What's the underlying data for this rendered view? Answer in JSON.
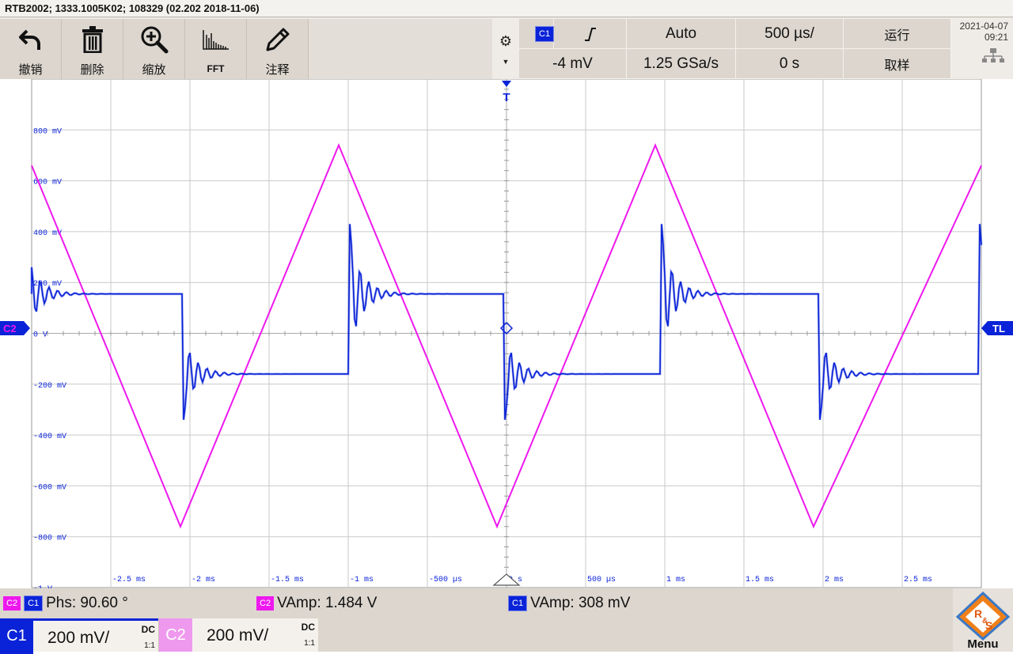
{
  "window": {
    "title": "RTB2002; 1333.1005K02; 108329 (02.202 2018-11-06)"
  },
  "toolbar": {
    "tools": [
      {
        "label": "撤销",
        "icon": "undo-icon"
      },
      {
        "label": "删除",
        "icon": "trash-icon"
      },
      {
        "label": "缩放",
        "icon": "zoom-icon"
      },
      {
        "label": "FFT",
        "icon": "fft-icon"
      },
      {
        "label": "注释",
        "icon": "pencil-icon"
      }
    ],
    "settings_icon": "gear-icon",
    "trigger_channel": "C1",
    "trigger_slope_icon": "rising-edge-icon",
    "trigger_mode": "Auto",
    "timebase": "500 µs/",
    "run_state": "运行",
    "trigger_level": "-4 mV",
    "sample_rate": "1.25 GSa/s",
    "horizontal_position": "0 s",
    "acquisition_mode": "取样",
    "date": "2021-04-07",
    "time": "09:21",
    "network_icon": "network-icon"
  },
  "plot": {
    "y_labels": [
      "800 mV",
      "600 mV",
      "400 mV",
      "200 mV",
      "0 V",
      "-200 mV",
      "-400 mV",
      "-600 mV",
      "-800 mV",
      "-1 V"
    ],
    "x_labels": [
      "-2.5 ms",
      "-2 ms",
      "-1.5 ms",
      "-1 ms",
      "-500 µs",
      "0 s",
      "500 µs",
      "1 ms",
      "1.5 ms",
      "2 ms",
      "2.5 ms"
    ],
    "left_marker": "C2",
    "right_marker": "TL",
    "trigger_marker": "T",
    "colors": {
      "c1": "#0a23d8",
      "c2": "#ee18ee",
      "grid": "#c9c9c9"
    }
  },
  "chart_data": {
    "type": "line",
    "xlabel": "",
    "ylabel": "",
    "xlim": [
      -3,
      3
    ],
    "ylim": [
      -1,
      1
    ],
    "x_unit": "ms",
    "y_unit": "V",
    "grid": true,
    "series": [
      {
        "name": "C2",
        "color": "#ee18ee",
        "shape": "triangle",
        "x": [
          -3.0,
          -2.06,
          -1.06,
          -0.06,
          0.94,
          1.94,
          3.0
        ],
        "y": [
          0.66,
          -0.76,
          0.74,
          -0.76,
          0.74,
          -0.76,
          0.66
        ]
      },
      {
        "name": "C1",
        "color": "#0a23d8",
        "shape": "square-with-ringing",
        "levels": [
          0.155,
          -0.16
        ],
        "transition_times": [
          -2.05,
          -1.0,
          -0.02,
          0.97,
          1.97,
          2.98
        ],
        "overshoot_peak": 0.43,
        "undershoot_peak": -0.34
      }
    ]
  },
  "measurements": [
    {
      "channels": [
        "C2",
        "C1"
      ],
      "text": "Phs: 90.60 °"
    },
    {
      "channels": [
        "C2"
      ],
      "text": "VAmp: 1.484 V"
    },
    {
      "channels": [
        "C1"
      ],
      "text": "VAmp: 308 mV"
    }
  ],
  "channels": [
    {
      "name": "C1",
      "scale": "200 mV/",
      "coupling": "DC",
      "ratio": "1:1"
    },
    {
      "name": "C2",
      "scale": "200 mV/",
      "coupling": "DC",
      "ratio": "1:1"
    }
  ],
  "menu": {
    "label": "Menu",
    "brand": "R&S"
  }
}
